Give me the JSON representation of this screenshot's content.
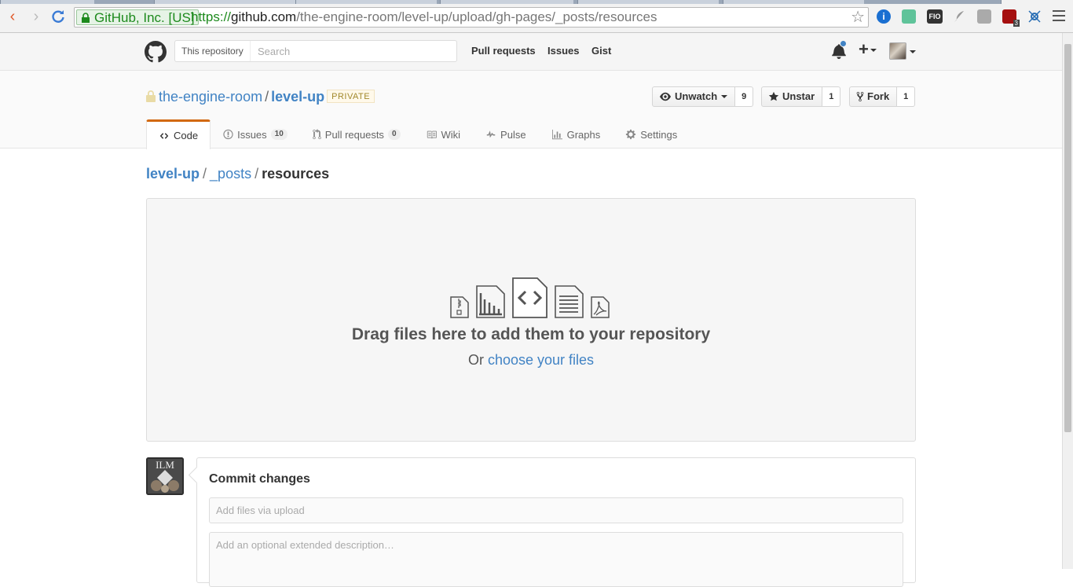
{
  "browser": {
    "ev_label": "GitHub, Inc. [US]",
    "url_scheme": "https://",
    "url_host": "github.com",
    "url_path": "/the-engine-room/level-up/upload/gh-pages/_posts/resources",
    "extensions": [
      "info-icon",
      "audio-icon",
      "fio-icon",
      "feather-icon",
      "camera-icon",
      "ublock-icon",
      "network-icon"
    ],
    "ext_fio_label": "FIO",
    "ext_ublock_badge": "3"
  },
  "header": {
    "scope_label": "This repository",
    "search_placeholder": "Search",
    "nav": [
      "Pull requests",
      "Issues",
      "Gist"
    ],
    "notification_color": "#4183c4"
  },
  "repo": {
    "owner": "the-engine-room",
    "name": "level-up",
    "visibility": "PRIVATE",
    "watch_label": "Unwatch",
    "watch_count": "9",
    "star_label": "Unstar",
    "star_count": "1",
    "fork_label": "Fork",
    "fork_count": "1"
  },
  "tabs": [
    {
      "label": "Code",
      "icon": "code-icon"
    },
    {
      "label": "Issues",
      "icon": "issue-icon",
      "count": "10"
    },
    {
      "label": "Pull requests",
      "icon": "pull-request-icon",
      "count": "0"
    },
    {
      "label": "Wiki",
      "icon": "book-icon"
    },
    {
      "label": "Pulse",
      "icon": "pulse-icon"
    },
    {
      "label": "Graphs",
      "icon": "graph-icon"
    },
    {
      "label": "Settings",
      "icon": "gear-icon"
    }
  ],
  "breadcrumb": {
    "root": "level-up",
    "dir": "_posts",
    "current": "resources"
  },
  "dropzone": {
    "title": "Drag files here to add them to your repository",
    "or_text": "Or",
    "link": "choose your files"
  },
  "commit": {
    "avatar_text": "ILM",
    "title": "Commit changes",
    "summary_placeholder": "Add files via upload",
    "description_placeholder": "Add an optional extended description…"
  },
  "colors": {
    "link": "#4183c4",
    "selected_tab_accent": "#d26911",
    "private_badge": "#a1882b"
  }
}
